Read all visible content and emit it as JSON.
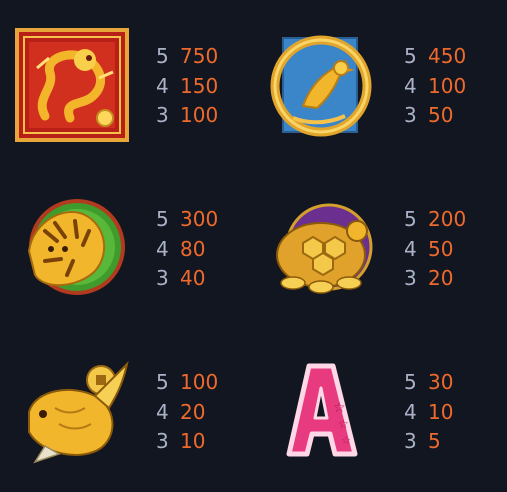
{
  "paytable": {
    "symbols": [
      {
        "name": "dragon",
        "pays": [
          {
            "count": "5",
            "amount": "750"
          },
          {
            "count": "4",
            "amount": "150"
          },
          {
            "count": "3",
            "amount": "100"
          }
        ]
      },
      {
        "name": "phoenix",
        "pays": [
          {
            "count": "5",
            "amount": "450"
          },
          {
            "count": "4",
            "amount": "100"
          },
          {
            "count": "3",
            "amount": "50"
          }
        ]
      },
      {
        "name": "tiger",
        "pays": [
          {
            "count": "5",
            "amount": "300"
          },
          {
            "count": "4",
            "amount": "80"
          },
          {
            "count": "3",
            "amount": "40"
          }
        ]
      },
      {
        "name": "turtle",
        "pays": [
          {
            "count": "5",
            "amount": "200"
          },
          {
            "count": "4",
            "amount": "50"
          },
          {
            "count": "3",
            "amount": "20"
          }
        ]
      },
      {
        "name": "koi-fish",
        "pays": [
          {
            "count": "5",
            "amount": "100"
          },
          {
            "count": "4",
            "amount": "20"
          },
          {
            "count": "3",
            "amount": "10"
          }
        ]
      },
      {
        "name": "letter-a",
        "letter": "A",
        "pays": [
          {
            "count": "5",
            "amount": "30"
          },
          {
            "count": "4",
            "amount": "10"
          },
          {
            "count": "3",
            "amount": "5"
          }
        ]
      }
    ]
  },
  "colors": {
    "background": "#121621",
    "count_text": "#a9b2c6",
    "amount_text": "#ee6a2c",
    "gold": "#f2b62c",
    "dragon_red": "#c0261b",
    "phoenix_blue": "#3a86c8",
    "tiger_green": "#3f9b2c",
    "turtle_purple": "#6b2f8f",
    "letter_pink": "#e83b7f"
  }
}
